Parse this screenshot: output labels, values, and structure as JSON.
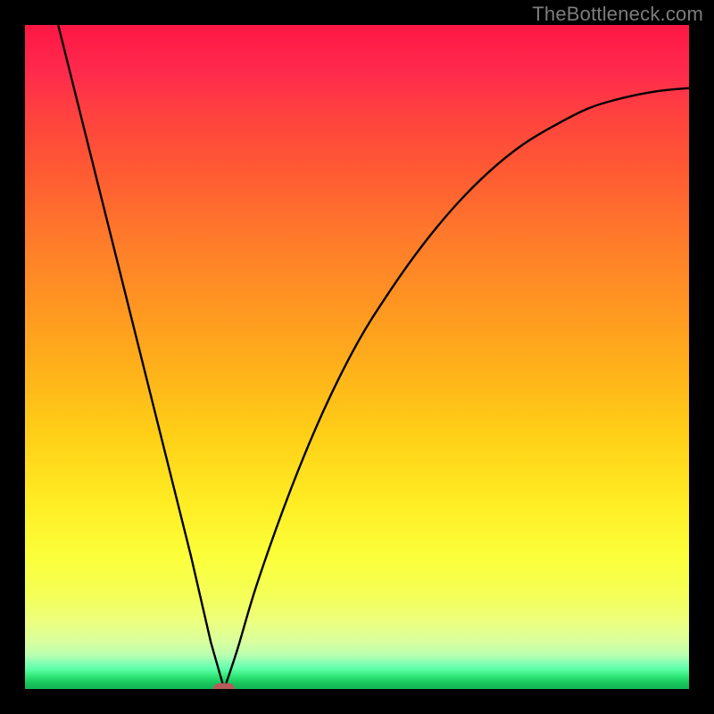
{
  "watermark": "TheBottleneck.com",
  "colors": {
    "frame": "#000000",
    "curve": "#000000",
    "marker": "#b85a5a",
    "watermark": "#7c7c7c"
  },
  "chart_data": {
    "type": "line",
    "title": "",
    "xlabel": "",
    "ylabel": "",
    "xlim": [
      0,
      100
    ],
    "ylim": [
      0,
      100
    ],
    "grid": false,
    "series": [
      {
        "name": "bottleneck-curve",
        "x": [
          5,
          10,
          15,
          20,
          25,
          28,
          30,
          32,
          35,
          40,
          45,
          50,
          55,
          60,
          65,
          70,
          75,
          80,
          85,
          90,
          95,
          100
        ],
        "values": [
          100,
          80,
          60,
          40,
          20,
          7,
          0,
          6,
          16,
          30,
          42,
          52,
          60,
          67,
          73,
          78,
          82,
          85,
          87.5,
          89,
          90,
          90.5
        ]
      }
    ],
    "annotations": [
      {
        "name": "optimal-marker",
        "x": 30,
        "y": 0
      }
    ],
    "background_gradient": {
      "top": "#ff1744",
      "mid": "#ffd017",
      "bottom": "#12b352"
    }
  }
}
